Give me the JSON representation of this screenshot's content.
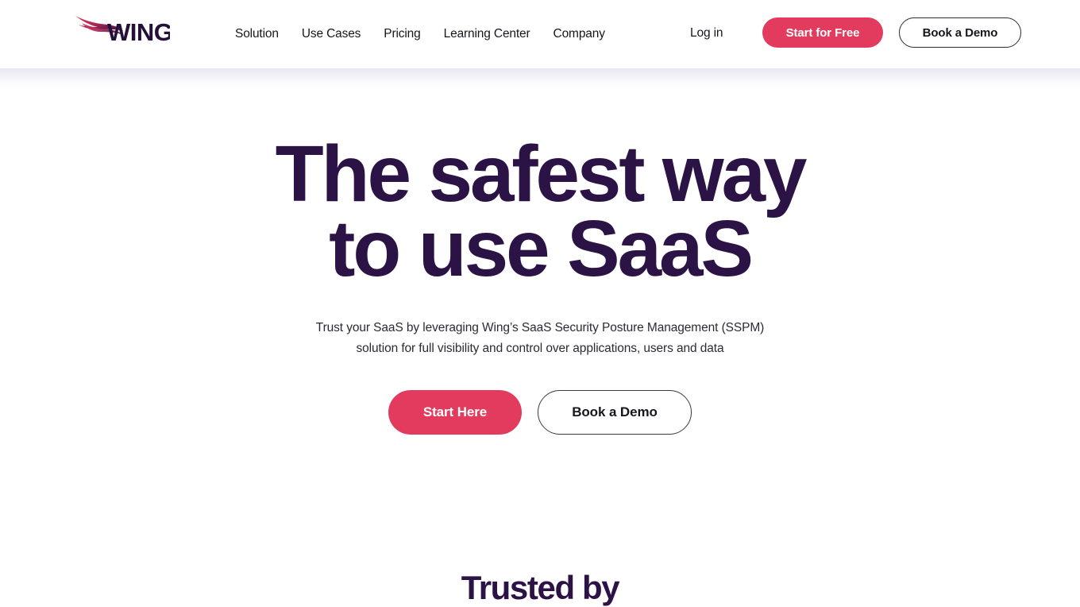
{
  "site": {
    "brand_name": "WING",
    "accent_color": "#e23b5d",
    "headline_color": "#2b1346",
    "text_color": "#16161d"
  },
  "header": {
    "logo_name": "wing-logo",
    "nav": [
      {
        "label": "Solution"
      },
      {
        "label": "Use Cases"
      },
      {
        "label": "Pricing"
      },
      {
        "label": "Learning Center"
      },
      {
        "label": "Company"
      }
    ],
    "login_label": "Log in",
    "start_free_label": "Start for Free",
    "book_demo_label": "Book a Demo"
  },
  "hero": {
    "headline_line1": "The safest way",
    "headline_line2": "to use SaaS",
    "subtitle_line1": "Trust your SaaS by leveraging Wing’s SaaS Security Posture Management (SSPM)",
    "subtitle_line2": "solution for full visibility and control over applications, users and data",
    "primary_cta_label": "Start Here",
    "secondary_cta_label": "Book a Demo"
  },
  "trusted": {
    "heading": "Trusted by"
  }
}
